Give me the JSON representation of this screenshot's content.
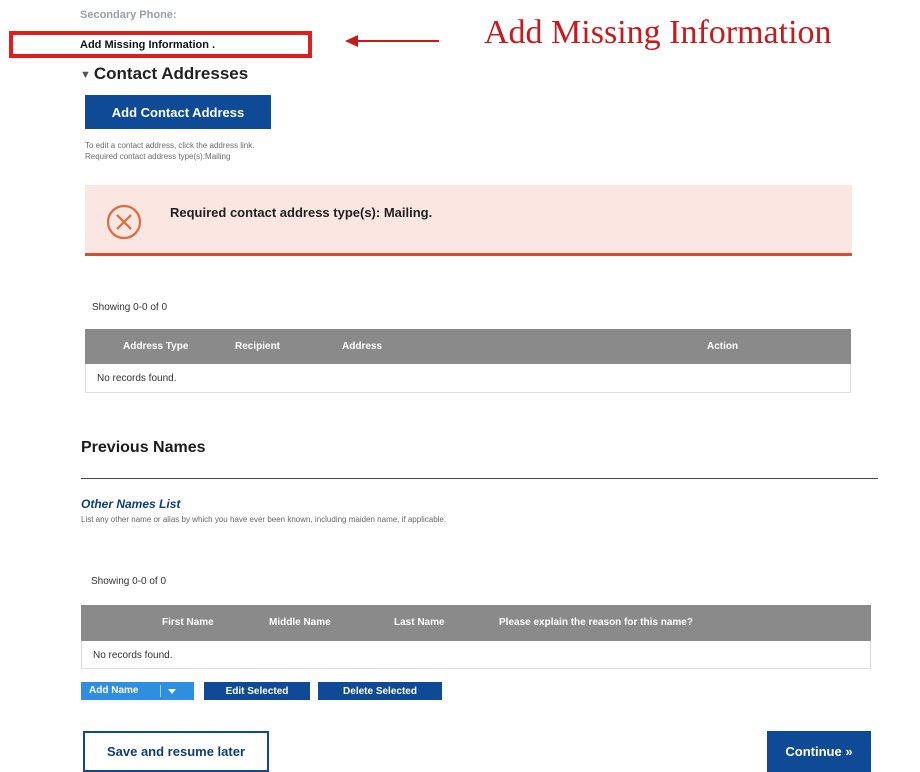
{
  "personal": {
    "secondary_phone_label": "Secondary Phone:"
  },
  "annotation": {
    "missing_label": "Add Missing Information  .",
    "callout": "Add Missing Information",
    "color": "#c8191d"
  },
  "contact": {
    "heading": "Contact Addresses",
    "add_button": "Add Contact Address",
    "hint_line1": "To edit a contact address, click the address link.",
    "hint_line2": "Required contact address type(s):Mailing",
    "alert_text": "Required contact address type(s): Mailing.",
    "alert_icon": "error-circle-x-icon",
    "table": {
      "showing": "Showing 0-0 of 0",
      "columns": [
        "Address Type",
        "Recipient",
        "Address",
        "Action"
      ],
      "empty_text": "No records found."
    }
  },
  "previous_names": {
    "heading": "Previous Names",
    "subheading": "Other Names List",
    "hint": "List any other name or alias by which you have ever been known, including maiden name, if applicable.",
    "table": {
      "showing": "Showing 0-0 of 0",
      "columns": [
        "First Name",
        "Middle Name",
        "Last Name",
        "Please explain the reason for this name?"
      ],
      "empty_text": "No records found."
    },
    "buttons": {
      "add": "Add Name",
      "edit": "Edit Selected",
      "delete": "Delete Selected"
    }
  },
  "footer": {
    "save": "Save and resume later",
    "continue": "Continue »"
  },
  "colors": {
    "primary": "#0f4a97",
    "secondary_button": "#2e8ee0",
    "alert_bg": "#fbe6e1",
    "alert_accent": "#d2502c",
    "header_gray": "#8a8a8a"
  }
}
